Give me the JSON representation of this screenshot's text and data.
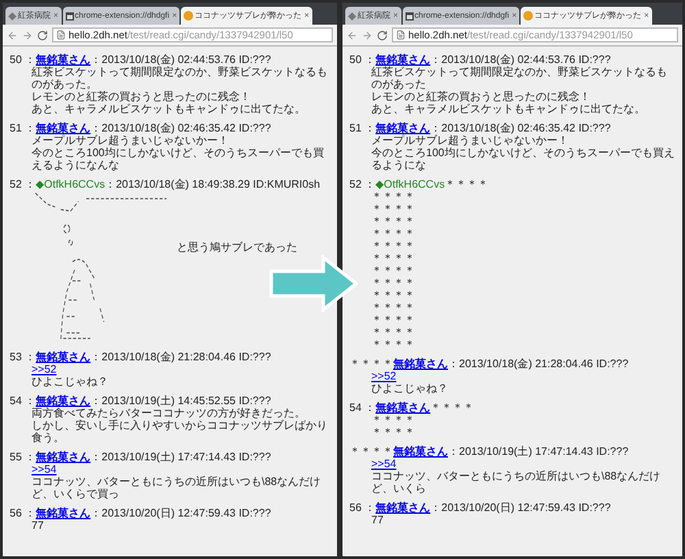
{
  "windows": [
    {
      "tabs": [
        {
          "title": "紅茶病院",
          "selected": false,
          "close": "×"
        },
        {
          "title": "chrome-extension://dhdgfi",
          "selected": false,
          "close": "×"
        },
        {
          "title": "ココナッツサブレが弊かった",
          "selected": true,
          "close": "×"
        }
      ],
      "url": {
        "host": "hello.2dh.net",
        "path": "/test/read.cgi/candy/1337942901/l50"
      },
      "posts": [
        {
          "number": "50 ：",
          "name": "無銘菓さん",
          "kind": "link",
          "info": "：2013/10/18(金) 02:44:53.76 ID:???",
          "lines": [
            "紅茶ビスケットって期間限定なのか、野菜ビスケットなるものがあった。",
            "レモンのと紅茶の買おうと思ったのに残念！",
            "あと、キャラメルビスケットもキャンドゥに出てたな。"
          ]
        },
        {
          "number": "51 ：",
          "name": "無銘菓さん",
          "kind": "link",
          "info": "：2013/10/18(金) 02:46:35.42 ID:???",
          "lines": [
            "メープルサブレ超うまいじゃないかー！",
            "今のところ100均にしかないけど、そのうちスーパーでも買えるようになんな"
          ]
        },
        {
          "number": "52 ：",
          "name": "◆OtfkH6CCvs",
          "kind": "trip",
          "info": "：2013/10/18(金) 18:49:38.29 ID:KMURI0sh",
          "art": {
            "caption": "と思う鳩サブレであった"
          }
        },
        {
          "number": "53 ：",
          "name": "無銘菓さん",
          "kind": "link",
          "info": "：2013/10/18(金) 21:28:04.46 ID:???",
          "reply": ">>52",
          "lines": [
            "ひよこじゃね？"
          ]
        },
        {
          "number": "54 ：",
          "name": "無銘菓さん",
          "kind": "link",
          "info": "：2013/10/19(土) 14:45:52.55 ID:???",
          "lines": [
            "両方食べてみたらバターココナッツの方が好きだった。",
            "しかし、安いし手に入りやすいからココナッツサブレばかり食う。"
          ]
        },
        {
          "number": "55 ：",
          "name": "無銘菓さん",
          "kind": "link",
          "info": "：2013/10/19(土) 17:47:14.43 ID:???",
          "reply": ">>54",
          "lines": [
            "ココナッツ、バターともにうちの近所はいつも\\88なんだけど、いくらで買っ"
          ]
        },
        {
          "number": "56 ：",
          "name": "無銘菓さん",
          "kind": "link",
          "info": "：2013/10/20(日) 12:47:59.43 ID:???",
          "lines": [
            "77"
          ]
        }
      ]
    },
    {
      "tabs": [
        {
          "title": "紅茶病院",
          "selected": false,
          "close": "×"
        },
        {
          "title": "chrome-extension://dhdgfi",
          "selected": false,
          "close": "×"
        },
        {
          "title": "ココナッツサブレが弊かった",
          "selected": true,
          "close": "×"
        }
      ],
      "url": {
        "host": "hello.2dh.net",
        "path": "/test/read.cgi/candy/1337942901/l50"
      },
      "posts": [
        {
          "number": "50 ：",
          "name": "無銘菓さん",
          "kind": "link",
          "info": "：2013/10/18(金) 02:44:53.76 ID:???",
          "lines": [
            "紅茶ビスケットって期間限定なのか、野菜ビスケットなるものがあった",
            "レモンのと紅茶の買おうと思ったのに残念！",
            "あと、キャラメルビスケットもキャンドゥに出てたな。"
          ]
        },
        {
          "number": "51 ：",
          "name": "無銘菓さん",
          "kind": "link",
          "info": "：2013/10/18(金) 02:46:35.42 ID:???",
          "lines": [
            "メープルサブレ超うまいじゃないかー！",
            "今のところ100均にしかないけど、そのうちスーパーでも買えるようにな"
          ]
        },
        {
          "number": "52 ：",
          "name": "◆OtfkH6CCvs",
          "kind": "trip",
          "info": "＊＊＊＊",
          "lines": [
            "＊＊＊＊",
            "＊＊＊＊",
            "＊＊＊＊",
            "＊＊＊＊",
            "＊＊＊＊",
            "＊＊＊＊",
            "＊＊＊＊",
            "＊＊＊＊",
            "＊＊＊＊",
            "＊＊＊＊",
            "＊＊＊＊",
            "＊＊＊＊",
            "＊＊＊＊"
          ]
        },
        {
          "prefix": "＊＊＊＊",
          "name": "無銘菓さん",
          "kind": "link",
          "info": "：2013/10/18(金) 21:28:04.46 ID:???",
          "reply": ">>52",
          "lines": [
            "ひよこじゃね？"
          ]
        },
        {
          "number": "54 ：",
          "name": "無銘菓さん",
          "kind": "link",
          "info": "＊＊＊＊",
          "lines": [
            "＊＊＊＊",
            "＊＊＊＊"
          ]
        },
        {
          "prefix": "＊＊＊＊",
          "name": "無銘菓さん",
          "kind": "link",
          "info": "：2013/10/19(土) 17:47:14.43 ID:???",
          "reply": ">>54",
          "lines": [
            "ココナッツ、バターともにうちの近所はいつも\\88なんだけど、いくら"
          ]
        },
        {
          "number": "56 ：",
          "name": "無銘菓さん",
          "kind": "link",
          "info": "：2013/10/20(日) 12:47:59.43 ID:???",
          "lines": [
            "77"
          ]
        }
      ]
    }
  ]
}
